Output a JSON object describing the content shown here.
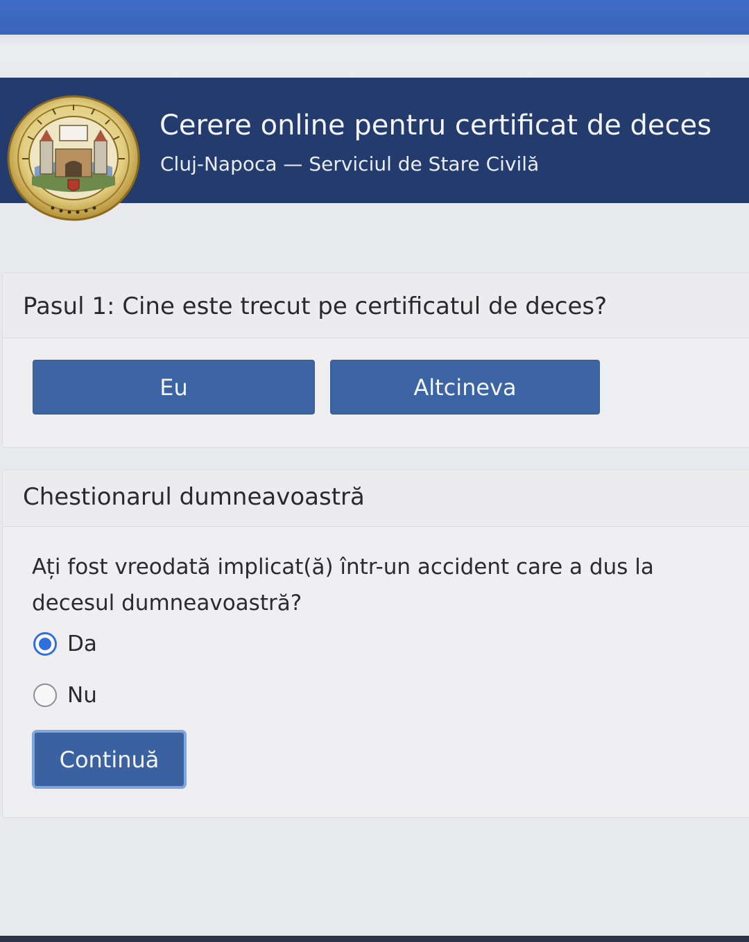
{
  "header": {
    "title": "Cerere online pentru certificat de deces",
    "subtitle": "Cluj-Napoca — Serviciul de Stare Civilă",
    "seal_icon": "city-seal-icon"
  },
  "step1": {
    "title": "Pasul 1: Cine este trecut pe certificatul de deces?",
    "options": [
      "Eu",
      "Altcineva"
    ]
  },
  "questionnaire": {
    "title": "Chestionarul dumneavoastră",
    "question": "Ați fost vreodată implicat(ă) într-un accident care a dus la decesul dumneavoastră?",
    "answers": [
      {
        "label": "Da",
        "selected": true
      },
      {
        "label": "Nu",
        "selected": false
      }
    ],
    "continue_label": "Continuă"
  },
  "colors": {
    "header_bg": "#243b6d",
    "button_bg": "#3c64a3",
    "radio_accent": "#2f6fe0",
    "top_bar": "#3f6cc7"
  }
}
